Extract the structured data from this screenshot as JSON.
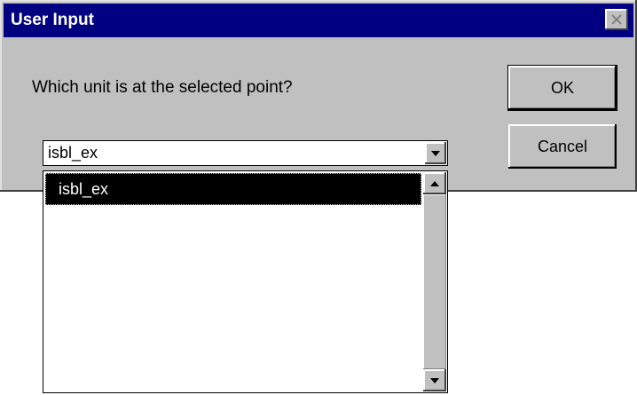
{
  "window": {
    "title": "User Input",
    "close_icon": "close-icon",
    "colors": {
      "titlebar": "#000080",
      "face": "#c0c0c0"
    }
  },
  "dialog": {
    "prompt": "Which unit is at the selected point?",
    "ok_label": "OK",
    "cancel_label": "Cancel"
  },
  "combo": {
    "value": "isbl_ex",
    "arrow_icon": "chevron-down-icon"
  },
  "dropdown": {
    "items": [
      {
        "label": "isbl_ex",
        "selected": true
      }
    ],
    "scroll_up_icon": "chevron-up-icon",
    "scroll_down_icon": "chevron-down-icon"
  }
}
